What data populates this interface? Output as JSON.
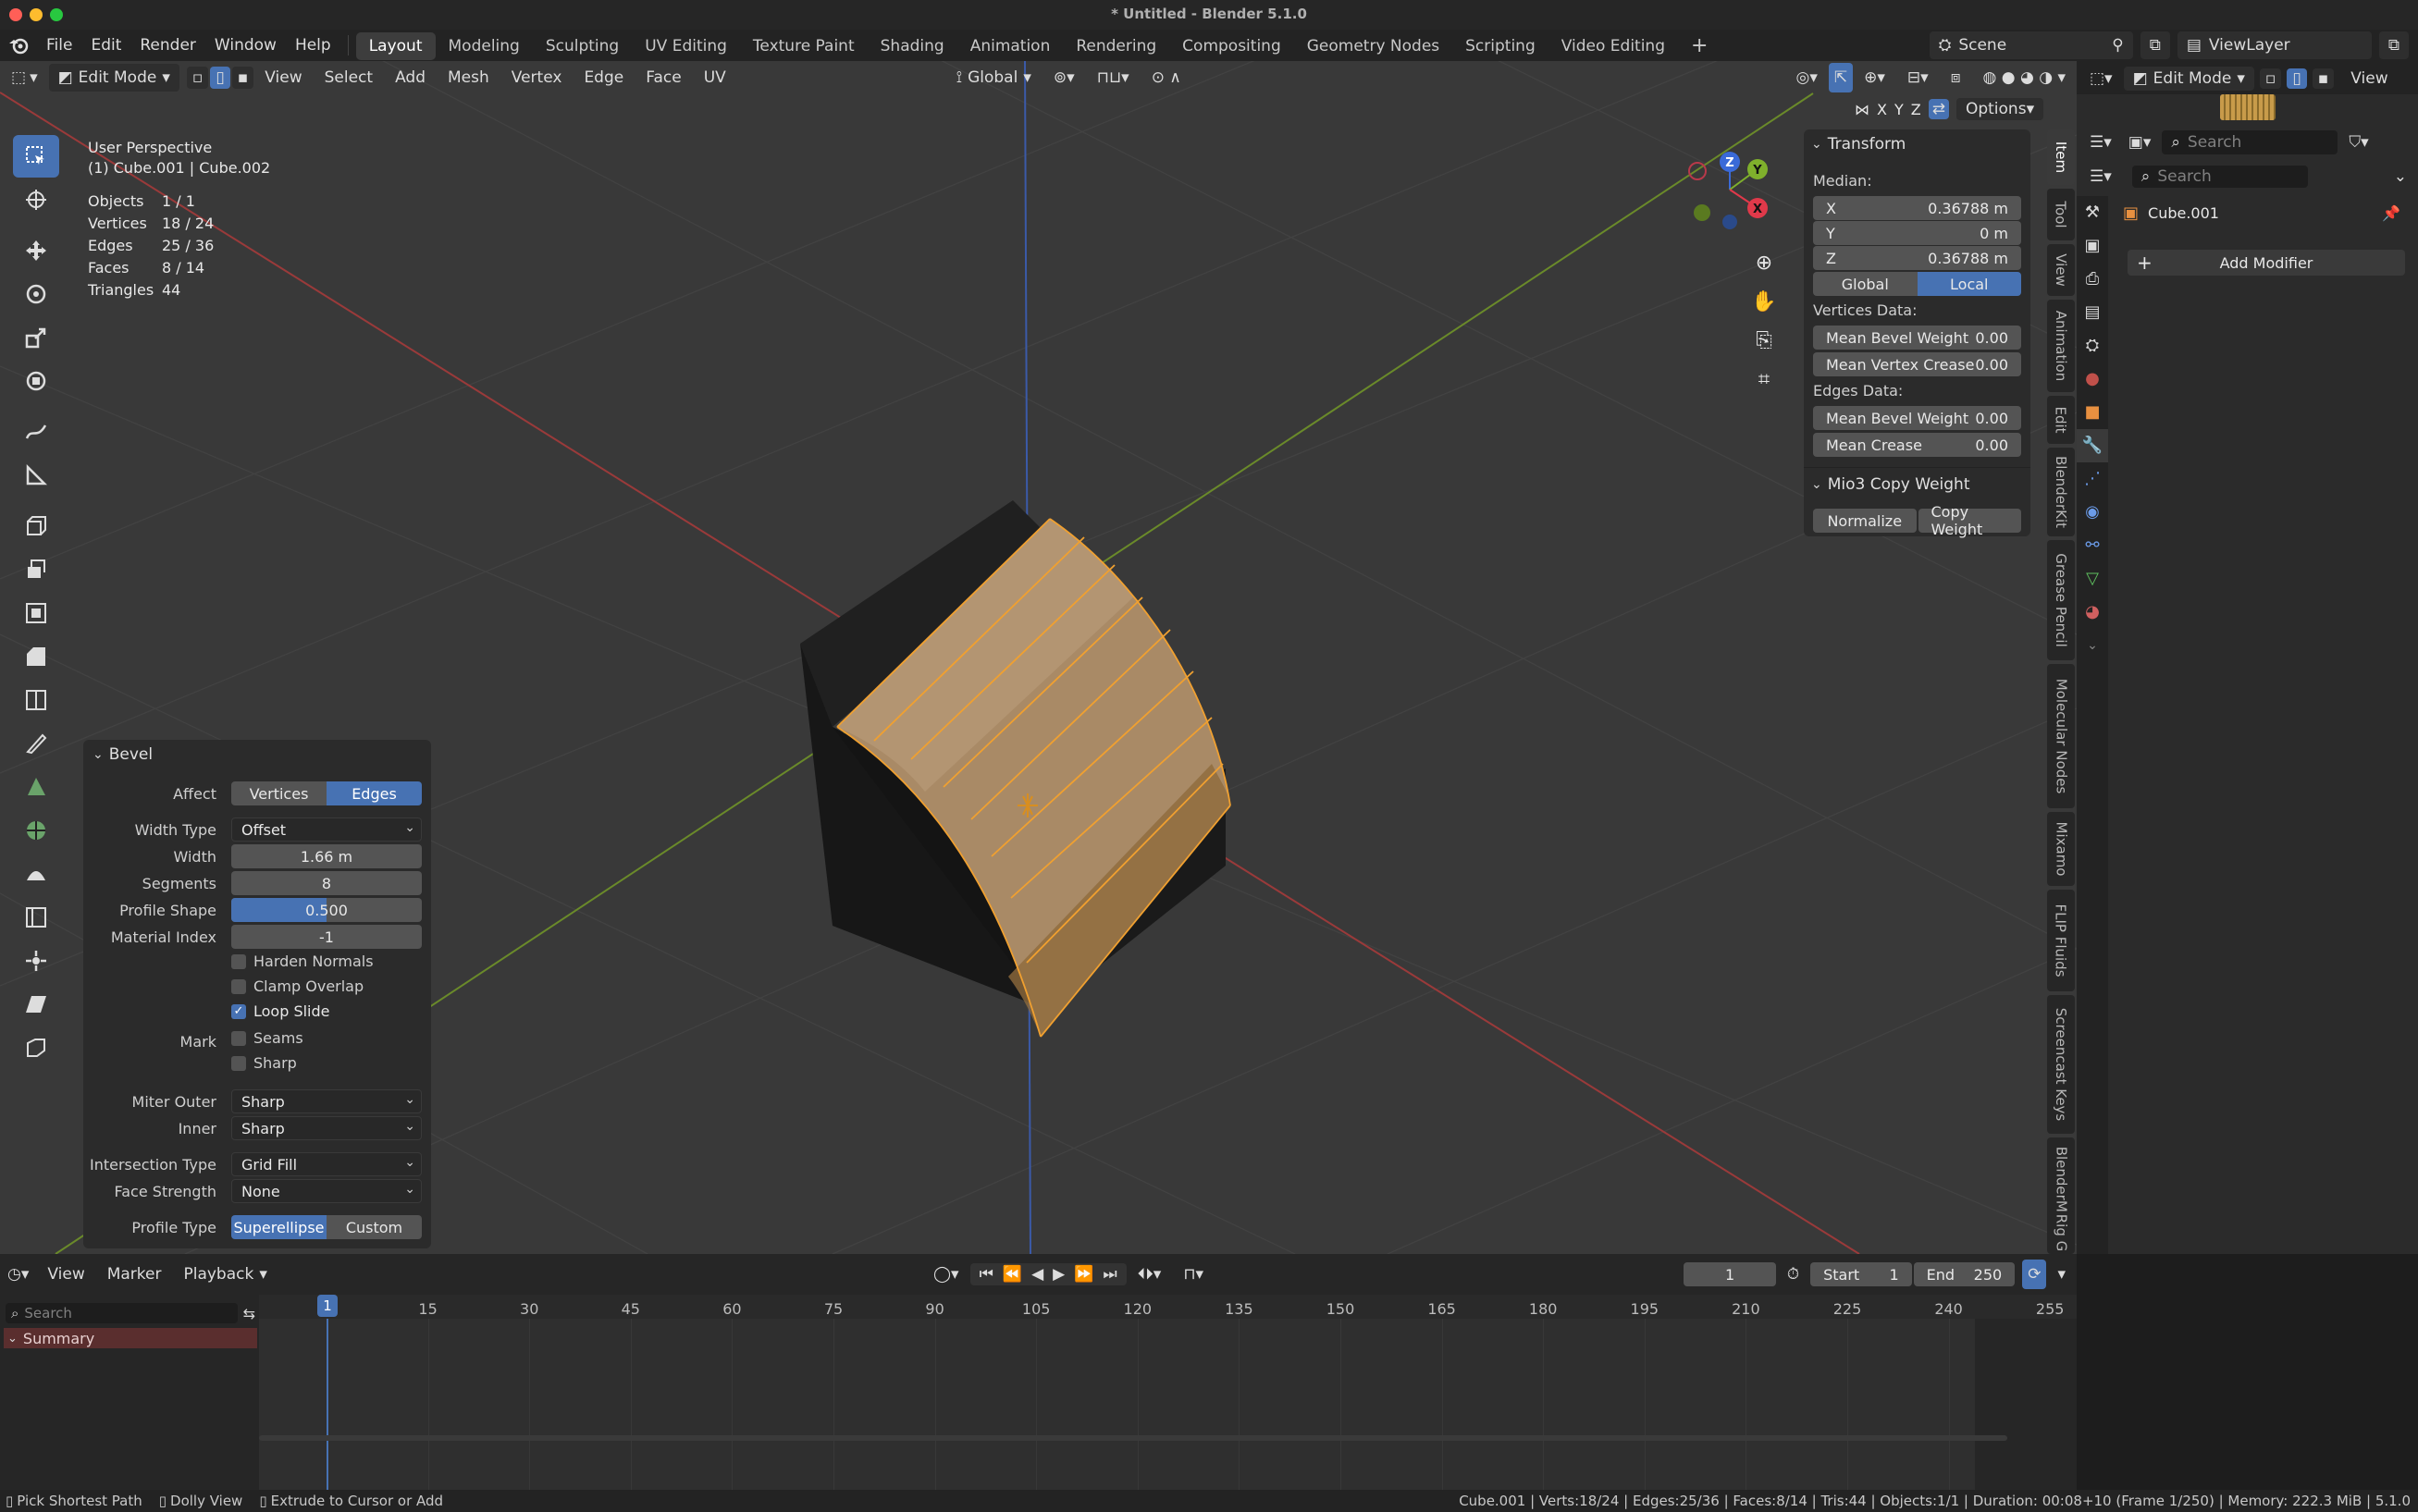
{
  "window": {
    "title": "* Untitled - Blender 5.1.0"
  },
  "menu": {
    "items": [
      "File",
      "Edit",
      "Render",
      "Window",
      "Help"
    ]
  },
  "workspaces": [
    "Layout",
    "Modeling",
    "Sculpting",
    "UV Editing",
    "Texture Paint",
    "Shading",
    "Animation",
    "Rendering",
    "Compositing",
    "Geometry Nodes",
    "Scripting",
    "Video Editing"
  ],
  "active_workspace": "Layout",
  "scene": {
    "name": "Scene",
    "viewlayer": "ViewLayer"
  },
  "viewport_header": {
    "mode": "Edit Mode",
    "menus": [
      "View",
      "Select",
      "Add",
      "Mesh",
      "Vertex",
      "Edge",
      "Face",
      "UV"
    ],
    "orientation": "Global",
    "axes": [
      "X",
      "Y",
      "Z"
    ],
    "options": "Options"
  },
  "overlay_stats": {
    "perspective": "User Perspective",
    "objects_line": "(1) Cube.001 | Cube.002",
    "rows": [
      {
        "label": "Objects",
        "value": "1 / 1"
      },
      {
        "label": "Vertices",
        "value": "18 / 24"
      },
      {
        "label": "Edges",
        "value": "25 / 36"
      },
      {
        "label": "Faces",
        "value": "8 / 14"
      },
      {
        "label": "Triangles",
        "value": "44"
      }
    ]
  },
  "gizmo": {
    "x": "X",
    "y": "Y",
    "z": "Z"
  },
  "n_panel": {
    "transform_title": "Transform",
    "median_label": "Median:",
    "x": {
      "label": "X",
      "value": "0.36788 m"
    },
    "y": {
      "label": "Y",
      "value": "0 m"
    },
    "z": {
      "label": "Z",
      "value": "0.36788 m"
    },
    "space": {
      "global": "Global",
      "local": "Local"
    },
    "vertices_data": "Vertices Data:",
    "mean_bevel_weight_v": {
      "label": "Mean Bevel Weight",
      "value": "0.00"
    },
    "mean_vertex_crease": {
      "label": "Mean Vertex Crease",
      "value": "0.00"
    },
    "edges_data": "Edges Data:",
    "mean_bevel_weight_e": {
      "label": "Mean Bevel Weight",
      "value": "0.00"
    },
    "mean_crease": {
      "label": "Mean Crease",
      "value": "0.00"
    },
    "mio3_title": "Mio3 Copy Weight",
    "normalize": "Normalize",
    "copy_weight": "Copy Weight"
  },
  "side_tabs": [
    "Item",
    "Tool",
    "View",
    "Animation",
    "Edit",
    "BlenderKit",
    "Grease Pencil",
    "Molecular Nodes",
    "Mixamo",
    "FLIP Fluids",
    "Screencast Keys",
    "BlenderMCP",
    "Rig G"
  ],
  "bevel": {
    "title": "Bevel",
    "affect": {
      "label": "Affect",
      "vertices": "Vertices",
      "edges": "Edges"
    },
    "width_type": {
      "label": "Width Type",
      "value": "Offset"
    },
    "width": {
      "label": "Width",
      "value": "1.66 m"
    },
    "segments": {
      "label": "Segments",
      "value": "8"
    },
    "profile_shape": {
      "label": "Profile Shape",
      "value": "0.500",
      "fraction": 0.5
    },
    "material_index": {
      "label": "Material Index",
      "value": "-1"
    },
    "harden_normals": "Harden Normals",
    "clamp_overlap": "Clamp Overlap",
    "loop_slide": "Loop Slide",
    "mark": {
      "label": "Mark",
      "seams": "Seams",
      "sharp": "Sharp"
    },
    "miter_outer": {
      "label": "Miter Outer",
      "value": "Sharp"
    },
    "inner": {
      "label": "Inner",
      "value": "Sharp"
    },
    "intersection_type": {
      "label": "Intersection Type",
      "value": "Grid Fill"
    },
    "face_strength": {
      "label": "Face Strength",
      "value": "None"
    },
    "profile_type": {
      "label": "Profile Type",
      "superellipse": "Superellipse",
      "custom": "Custom"
    }
  },
  "properties": {
    "mode": "Edit Mode",
    "view": "View",
    "search_placeholder": "Search",
    "object_name": "Cube.001",
    "add_modifier": "Add Modifier"
  },
  "timeline": {
    "menus": [
      "View",
      "Marker",
      "Playback"
    ],
    "current_frame": "1",
    "start_label": "Start",
    "start": "1",
    "end_label": "End",
    "end": "250",
    "search_placeholder": "Search",
    "summary": "Summary",
    "frames": [
      "1",
      "15",
      "30",
      "45",
      "60",
      "75",
      "90",
      "105",
      "120",
      "135",
      "150",
      "165",
      "180",
      "195",
      "210",
      "225",
      "240",
      "255"
    ]
  },
  "statusbar": {
    "hints": [
      "Pick Shortest Path",
      "Dolly View",
      "Extrude to Cursor or Add"
    ],
    "info": "Cube.001 | Verts:18/24 | Edges:25/36 | Faces:8/14 | Tris:44 | Objects:1/1 | Duration: 00:08+10 (Frame 1/250) | Memory: 222.3 MiB | 5.1.0"
  },
  "colors": {
    "accent": "#4772b3",
    "selection": "#f0a030",
    "viewport_bg": "#393939",
    "panel_bg": "#2b2b2b"
  }
}
